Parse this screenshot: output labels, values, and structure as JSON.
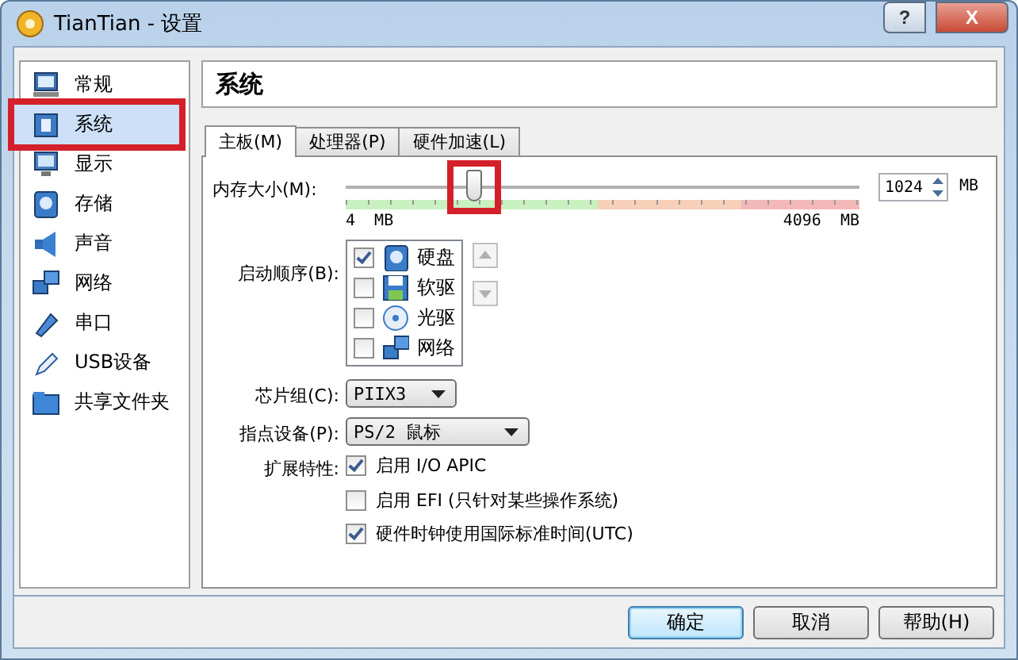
{
  "window": {
    "title": "TianTian - 设置",
    "help_button": "?",
    "close_button": "X"
  },
  "sidebar": {
    "items": [
      {
        "label": "常规",
        "selected": false,
        "highlighted": false
      },
      {
        "label": "系统",
        "selected": true,
        "highlighted": true
      },
      {
        "label": "显示",
        "selected": false,
        "highlighted": false
      },
      {
        "label": "存储",
        "selected": false,
        "highlighted": false
      },
      {
        "label": "声音",
        "selected": false,
        "highlighted": false
      },
      {
        "label": "网络",
        "selected": false,
        "highlighted": false
      },
      {
        "label": "串口",
        "selected": false,
        "highlighted": false
      },
      {
        "label": "USB设备",
        "selected": false,
        "highlighted": false
      },
      {
        "label": "共享文件夹",
        "selected": false,
        "highlighted": false
      }
    ]
  },
  "page_title": "系统",
  "tabs": [
    {
      "label": "主板(M)",
      "selected": true
    },
    {
      "label": "处理器(P)",
      "selected": false
    },
    {
      "label": "硬件加速(L)",
      "selected": false
    }
  ],
  "memory": {
    "label": "内存大小(M):",
    "level": 0.25,
    "highlighted": true,
    "min_label": "4  MB",
    "max_label": "4096  MB",
    "value": "1024",
    "unit": "MB"
  },
  "boot_order": {
    "label": "启动顺序(B):",
    "items": [
      {
        "label": "硬盘",
        "checked": true
      },
      {
        "label": "软驱",
        "checked": false
      },
      {
        "label": "光驱",
        "checked": false
      },
      {
        "label": "网络",
        "checked": false
      }
    ],
    "up_disabled": true,
    "down_disabled": true
  },
  "chipset": {
    "label": "芯片组(C):",
    "value": "PIIX3"
  },
  "pointing_device": {
    "label": "指点设备(P):",
    "value": "PS/2 鼠标"
  },
  "extended_features": {
    "label": "扩展特性:",
    "options": [
      {
        "label": "启用 I/O APIC",
        "checked": true
      },
      {
        "label": "启用 EFI (只针对某些操作系统)",
        "checked": false
      },
      {
        "label": "硬件时钟使用国际标准时间(UTC)",
        "checked": true
      }
    ]
  },
  "buttons": [
    {
      "label": "确定",
      "default": true
    },
    {
      "label": "取消",
      "default": false
    },
    {
      "label": "帮助(H)",
      "default": false
    }
  ]
}
